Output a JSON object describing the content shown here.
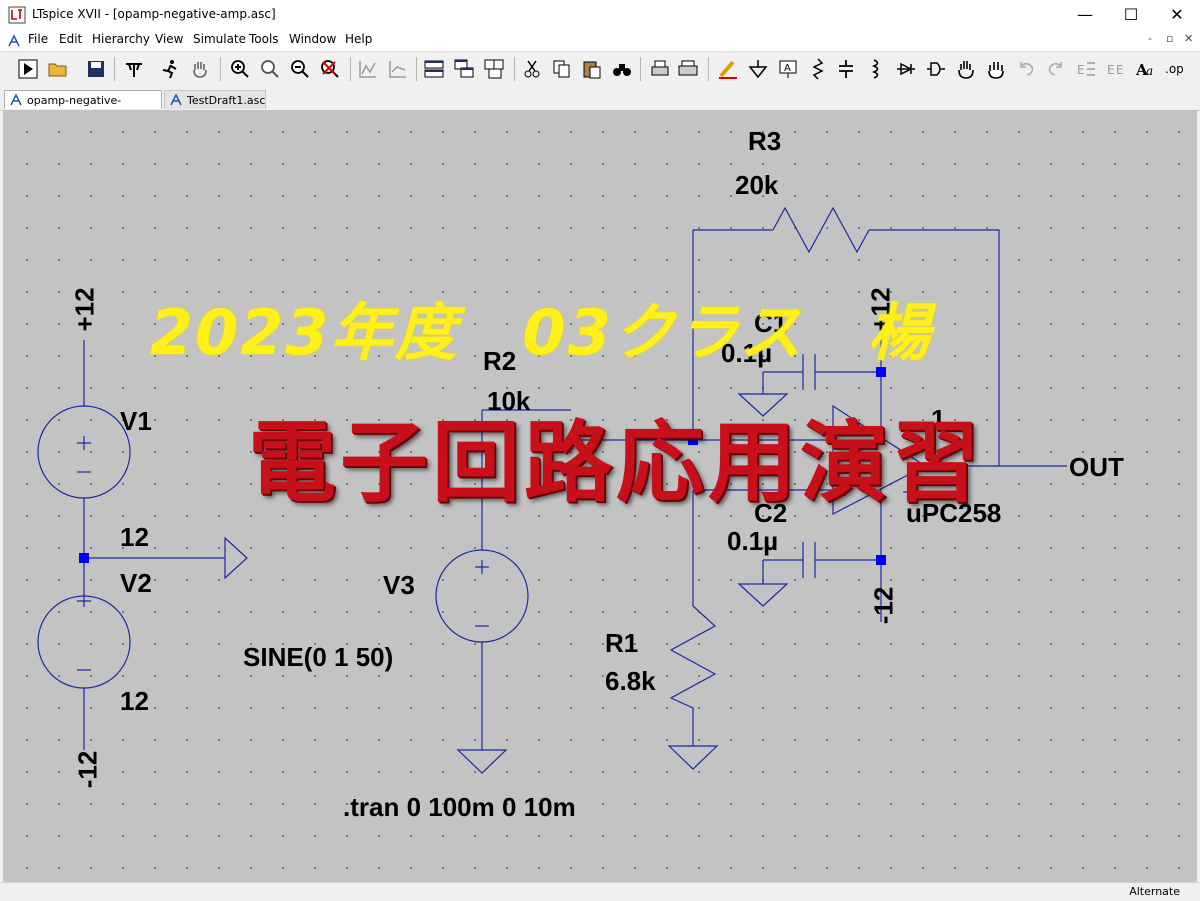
{
  "window": {
    "title": "LTspice XVII - [opamp-negative-amp.asc]",
    "minimize_icon": "minimize-icon",
    "maximize_icon": "maximize-icon",
    "close_icon": "close-icon"
  },
  "menubar": {
    "items": [
      "File",
      "Edit",
      "Hierarchy",
      "View",
      "Simulate",
      "Tools",
      "Window",
      "Help"
    ],
    "mdi_buttons": [
      "-",
      "▫",
      "✕"
    ]
  },
  "toolbar": {
    "icons": [
      "run-icon",
      "open-icon",
      "save-icon",
      "control-panel-icon",
      "halt-icon",
      "pan-icon",
      "zoom-in-icon",
      "zoom-pan-icon",
      "zoom-out-icon",
      "zoom-fit-icon",
      "autorange-icon",
      "tile-horizontal-icon",
      "cascade-icon",
      "tile-icon",
      "cut-icon",
      "copy-icon",
      "paste-icon",
      "find-icon",
      "print-icon",
      "print-setup-icon",
      "draw-wire-icon",
      "ground-icon",
      "label-net-icon",
      "resistor-icon",
      "capacitor-icon",
      "inductor-icon",
      "diode-icon",
      "component-icon",
      "move-icon",
      "drag-icon",
      "undo-icon",
      "redo-icon",
      "rotate-icon",
      "mirror-icon",
      "text-icon",
      "spice-directive-icon"
    ]
  },
  "tabs": [
    {
      "label": "opamp-negative-amp.asc",
      "active": true
    },
    {
      "label": "TestDraft1.asc",
      "active": false
    }
  ],
  "schematic": {
    "r3_name": "R3",
    "r3_value": "20k",
    "r2_name": "R2",
    "r2_value": "10k",
    "r1_name": "R1",
    "r1_value": "6.8k",
    "c1_name": "C1",
    "c1_value": "0.1µ",
    "c2_name": "C2",
    "c2_value": "0.1µ",
    "v1_name": "V1",
    "v1_value": "12",
    "v2_name": "V2",
    "v2_value": "12",
    "v3_name": "V3",
    "v3_value": "SINE(0 1 50)",
    "plus12_left": "+12",
    "minus12_left": "-12",
    "plus12_right": "+12",
    "minus12_right": "-12",
    "out_label": "OUT",
    "opamp_model": "uPC258",
    "opamp_ref_partial": "1",
    "directive": ".tran 0 100m 0 10m",
    "wire_color": "#1a2aa0",
    "node_color": "#0000ff"
  },
  "overlay": {
    "yellow_text": "2023年度　03クラス　楊",
    "red_text": "電子回路応用演習",
    "yellow_color": "#ffef1a",
    "red_color": "#c8101a"
  },
  "status": {
    "mode": "Alternate"
  }
}
